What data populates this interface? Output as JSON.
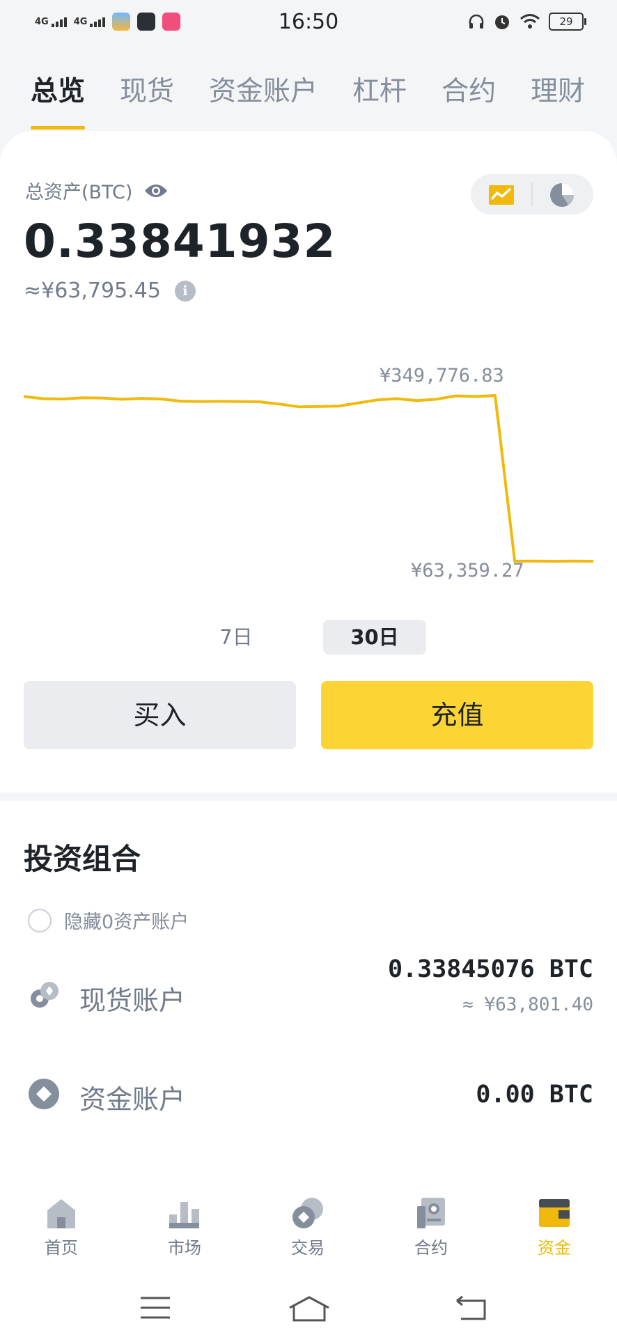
{
  "status_bar": {
    "signal1": "4G",
    "signal2": "4G",
    "time": "16:50",
    "battery": "29"
  },
  "tabs": [
    {
      "label": "总览",
      "active": true
    },
    {
      "label": "现货",
      "active": false
    },
    {
      "label": "资金账户",
      "active": false
    },
    {
      "label": "杠杆",
      "active": false
    },
    {
      "label": "合约",
      "active": false
    },
    {
      "label": "理财",
      "active": false
    }
  ],
  "overview": {
    "total_label": "总资产(BTC)",
    "total_btc": "0.33841932",
    "total_fiat": "≈¥63,795.45"
  },
  "chart_data": {
    "type": "line",
    "series": [
      {
        "values": [
          326000,
          322500,
          322000,
          324000,
          323500,
          321500,
          323000,
          322000,
          318500,
          318000,
          318200,
          318000,
          317500,
          314000,
          309500,
          310000,
          310500,
          315500,
          320500,
          322500,
          319500,
          321500,
          327000,
          326000,
          327500,
          63800,
          64000,
          63700,
          64000,
          63700
        ]
      }
    ],
    "annotations": {
      "max_label": "¥349,776.83",
      "min_label": "¥63,359.27"
    },
    "color": "#f0b90b"
  },
  "periods": [
    {
      "label": "7日",
      "selected": false
    },
    {
      "label": "30日",
      "selected": true
    }
  ],
  "actions": {
    "buy": "买入",
    "deposit": "充值"
  },
  "portfolio": {
    "title": "投资组合",
    "hide_zero_label": "隐藏0资产账户",
    "accounts": [
      {
        "name": "现货账户",
        "value": "0.33845076 BTC",
        "fiat": "≈ ¥63,801.40"
      },
      {
        "name": "资金账户",
        "value": "0.00 BTC",
        "fiat": ""
      }
    ]
  },
  "bottom_nav": [
    {
      "label": "首页",
      "active": false
    },
    {
      "label": "市场",
      "active": false
    },
    {
      "label": "交易",
      "active": false
    },
    {
      "label": "合约",
      "active": false
    },
    {
      "label": "资金",
      "active": true
    }
  ],
  "colors": {
    "accent": "#f0b90b",
    "primary_button": "#fcd535"
  }
}
